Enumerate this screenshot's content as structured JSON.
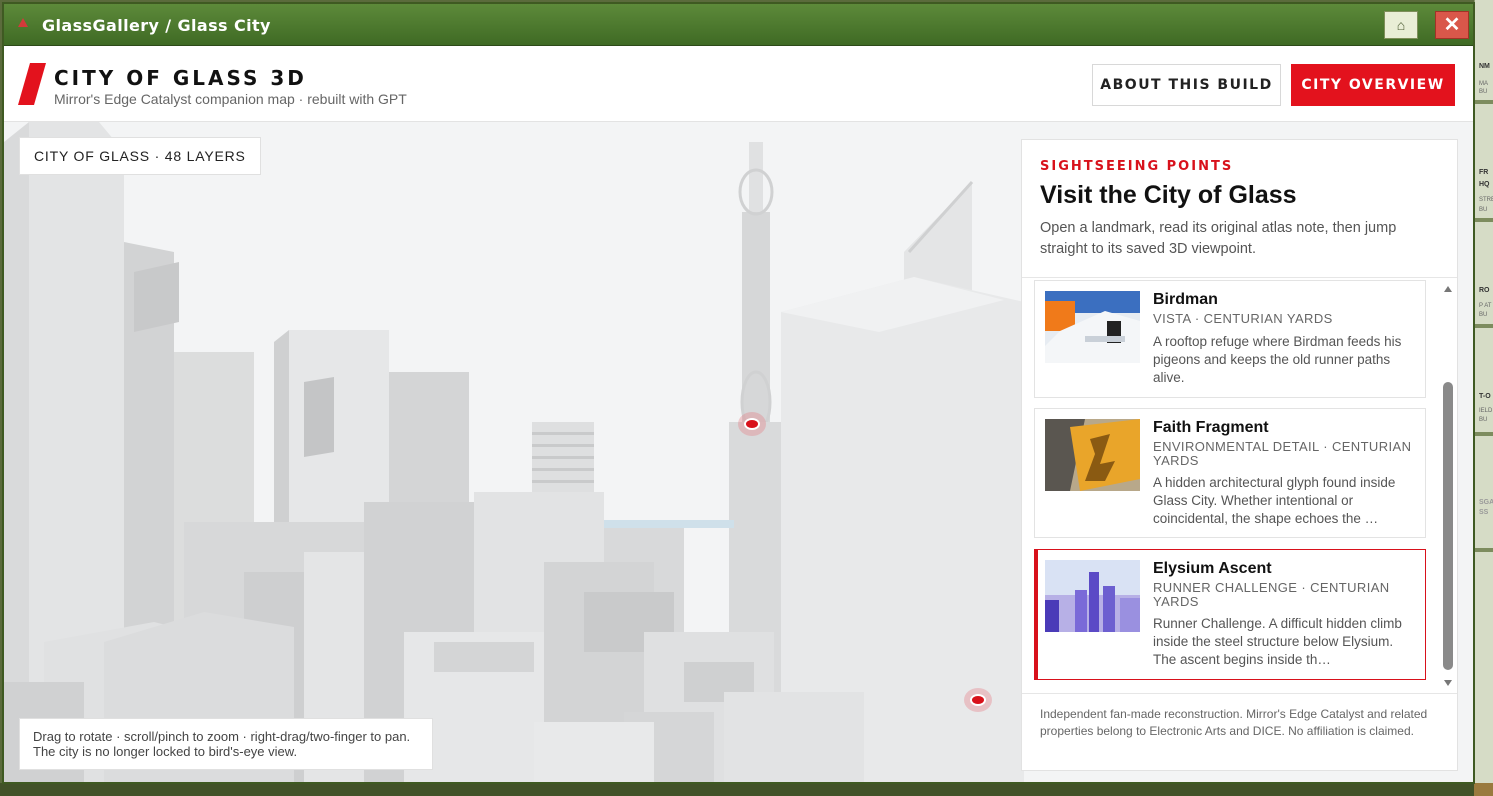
{
  "window": {
    "title": "GlassGallery / Glass City",
    "home_glyph": "⌂",
    "close_glyph": "✕"
  },
  "header": {
    "title": "CITY OF GLASS 3D",
    "subtitle": "Mirror's Edge Catalyst companion map · rebuilt with GPT",
    "about_label": "ABOUT THIS BUILD",
    "overview_label": "CITY OVERVIEW"
  },
  "viewport": {
    "layers_badge": "CITY OF GLASS · 48 LAYERS",
    "hint": "Drag to rotate · scroll/pinch to zoom · right-drag/two-finger to pan. The city is no longer locked to bird's-eye view."
  },
  "panel": {
    "kicker": "SIGHTSEEING POINTS",
    "title": "Visit the City of Glass",
    "description": "Open a landmark, read its original atlas note, then jump straight to its saved 3D viewpoint.",
    "items": [
      {
        "name": "Birdman",
        "meta": "VISTA · CENTURIAN YARDS",
        "text": "A rooftop refuge where Birdman feeds his pigeons and keeps the old runner paths alive."
      },
      {
        "name": "Faith Fragment",
        "meta": "ENVIRONMENTAL DETAIL · CENTURIAN YARDS",
        "text": "A hidden architectural glyph found inside Glass City. Whether intentional or coincidental, the shape echoes the …"
      },
      {
        "name": "Elysium Ascent",
        "meta": "RUNNER CHALLENGE · CENTURIAN YARDS",
        "text": "Runner Challenge. A difficult hidden climb inside the steel structure below Elysium. The ascent begins inside th…"
      }
    ],
    "footer": "Independent fan-made reconstruction. Mirror's Edge Catalyst and related properties belong to Electronic Arts and DICE. No affiliation is claimed."
  },
  "background": {
    "fragments": [
      "NM",
      "MA",
      "BU",
      "FR",
      "HQ",
      "STRE",
      "BU",
      "RO",
      "P AT",
      "BU",
      "T-O",
      "IELD",
      "BU",
      "SGA",
      "SS"
    ]
  },
  "colors": {
    "accent": "#e3121d",
    "titlebar": "#4f7a2f",
    "viewport_bg": "#f2f3f4"
  }
}
